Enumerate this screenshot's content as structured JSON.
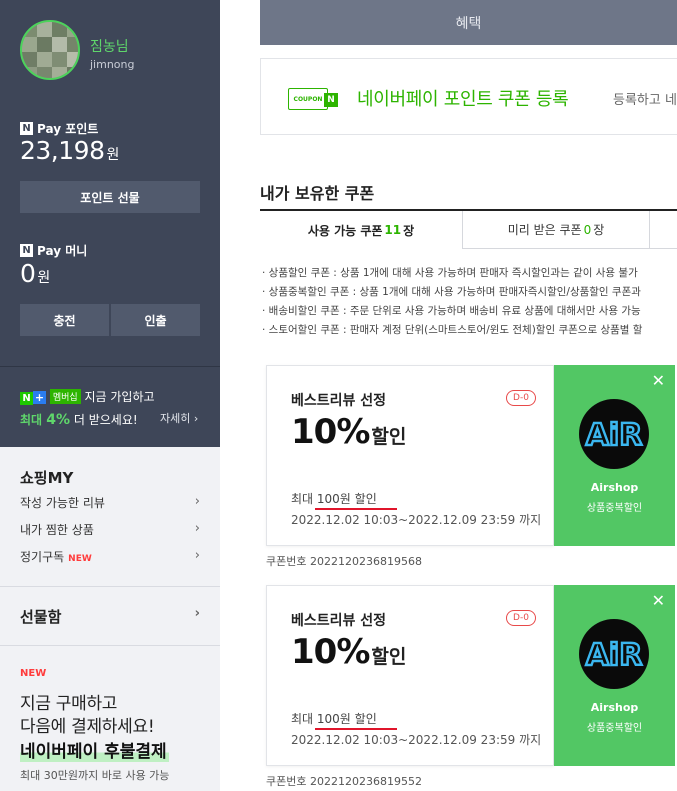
{
  "sidebar": {
    "profile": {
      "name": "짐농님",
      "id": "jimnong"
    },
    "points": {
      "brand": "N",
      "label": "Pay 포인트",
      "amount": "23,198",
      "unit": "원",
      "gift_button": "포인트 선물"
    },
    "money": {
      "brand": "N",
      "label": "Pay 머니",
      "amount": "0",
      "unit": "원",
      "charge_button": "충전",
      "withdraw_button": "인출"
    },
    "membership": {
      "badge_n": "N",
      "badge_plus": "+",
      "badge_text": "멤버십",
      "line1": "지금 가입하고",
      "line2_prefix": "최대 ",
      "line2_pct": "4%",
      "line2_suffix": " 더 받으세요!",
      "detail_link": "자세히 ›"
    },
    "shopping_my": {
      "title": "쇼핑MY",
      "items": [
        {
          "label": "작성 가능한 리뷰",
          "chevron": "›"
        },
        {
          "label": "내가 찜한 상품",
          "chevron": "›"
        },
        {
          "label": "정기구독",
          "new_tag": "NEW",
          "chevron": "›"
        }
      ]
    },
    "giftbox": {
      "title": "선물함",
      "chevron": "›"
    },
    "promo": {
      "new_tag": "NEW",
      "line1": "지금 구매하고",
      "line2": "다음에 결제하세요!",
      "strong": "네이버페이 후불결제",
      "sub": "최대 30만원까지 바로 사용 가능"
    }
  },
  "main": {
    "benefit_tab": "혜택",
    "register": {
      "icon_text": "COUPON",
      "icon_n": "N",
      "title": "네이버페이 포인트 쿠폰 등록",
      "desc": "등록하고 네"
    },
    "owned_title": "내가 보유한 쿠폰",
    "tabs": {
      "usable_prefix": "사용 가능 쿠폰 ",
      "usable_count": "11",
      "usable_suffix": " 장",
      "received_prefix": "미리 받은 쿠폰 ",
      "received_count": "0",
      "received_suffix": "장"
    },
    "notes": [
      "· 상품할인 쿠폰 : 상품 1개에 대해 사용 가능하며 판매자 즉시할인과는 같이 사용 불가",
      "· 상품중복할인 쿠폰 : 상품 1개에 대해 사용 가능하며 판매자즉시할인/상품할인 쿠폰과",
      "· 배송비할인 쿠폰 : 주문 단위로 사용 가능하며 배송비 유료 상품에 대해서만 사용 가능",
      "· 스토어할인 쿠폰 : 판매자 계정 단위(스마트스토어/윈도 전체)할인 쿠폰으로 상품별 할"
    ],
    "coupons": [
      {
        "title": "베스트리뷰 선정",
        "dday": "D-0",
        "rate": "10%",
        "rate_label": "할인",
        "max": "최대 100원 할인",
        "period": "2022.12.02 10:03~2022.12.09 23:59 까지",
        "store_name": "Airshop",
        "store_type": "상품중복할인",
        "close": "✕",
        "coupon_no": "쿠폰번호 2022120236819568"
      },
      {
        "title": "베스트리뷰 선정",
        "dday": "D-0",
        "rate": "10%",
        "rate_label": "할인",
        "max": "최대 100원 할인",
        "period": "2022.12.02 10:03~2022.12.09 23:59 까지",
        "store_name": "Airshop",
        "store_type": "상품중복할인",
        "close": "✕",
        "coupon_no": "쿠폰번호 2022120236819552"
      }
    ],
    "colors": {
      "naver_green": "#2db400",
      "store_green": "#52c764",
      "sidebar_dark": "#3e4658",
      "dday_red": "#e84a4a"
    }
  }
}
